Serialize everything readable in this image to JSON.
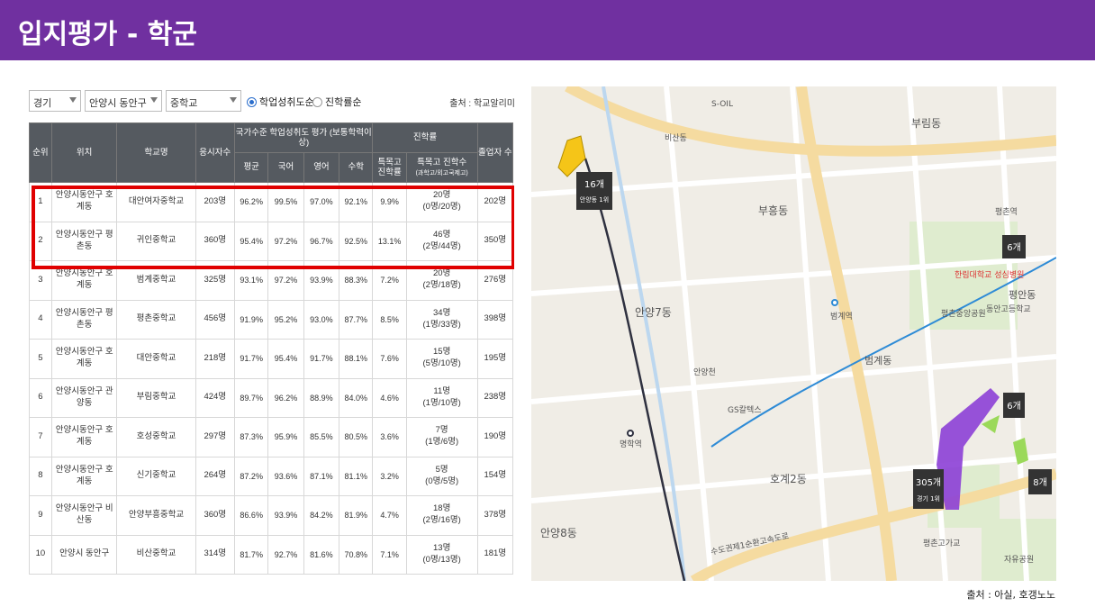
{
  "page": {
    "title": "입지평가 - 학군",
    "credit": "출처 : 아실, 호갱노노"
  },
  "filters": {
    "region": "경기",
    "district": "안양시 동안구",
    "level": "중학교",
    "radio_1": "학업성취도순",
    "radio_2": "진학률순",
    "source": "출처 : 학교알리미"
  },
  "table": {
    "headers": {
      "rank": "순위",
      "location": "위치",
      "school": "학교명",
      "takers": "응시자수",
      "achievement_group": "국가수준 학업성취도 평가 (보통학력이상)",
      "avg": "평균",
      "korean": "국어",
      "english": "영어",
      "math": "수학",
      "advance_group": "진학률",
      "special_rate": "특목고 진학률",
      "special_count": "특목고 진학수",
      "special_count_sub": "(과학고/외고국제고)",
      "graduates": "졸업자 수"
    },
    "rows": [
      {
        "rank": "1",
        "loc": "안양시동안구 호계동",
        "school": "대안여자중학교",
        "takers": "203명",
        "avg": "96.2%",
        "kor": "99.5%",
        "eng": "97.0%",
        "math": "92.1%",
        "rate": "9.9%",
        "cnt": "20명",
        "cnt_sub": "(0명/20명)",
        "grad": "202명"
      },
      {
        "rank": "2",
        "loc": "안양시동안구 평촌동",
        "school": "귀인중학교",
        "takers": "360명",
        "avg": "95.4%",
        "kor": "97.2%",
        "eng": "96.7%",
        "math": "92.5%",
        "rate": "13.1%",
        "cnt": "46명",
        "cnt_sub": "(2명/44명)",
        "grad": "350명"
      },
      {
        "rank": "3",
        "loc": "안양시동안구 호계동",
        "school": "범계중학교",
        "takers": "325명",
        "avg": "93.1%",
        "kor": "97.2%",
        "eng": "93.9%",
        "math": "88.3%",
        "rate": "7.2%",
        "cnt": "20명",
        "cnt_sub": "(2명/18명)",
        "grad": "276명"
      },
      {
        "rank": "4",
        "loc": "안양시동안구 평촌동",
        "school": "평촌중학교",
        "takers": "456명",
        "avg": "91.9%",
        "kor": "95.2%",
        "eng": "93.0%",
        "math": "87.7%",
        "rate": "8.5%",
        "cnt": "34명",
        "cnt_sub": "(1명/33명)",
        "grad": "398명"
      },
      {
        "rank": "5",
        "loc": "안양시동안구 호계동",
        "school": "대안중학교",
        "takers": "218명",
        "avg": "91.7%",
        "kor": "95.4%",
        "eng": "91.7%",
        "math": "88.1%",
        "rate": "7.6%",
        "cnt": "15명",
        "cnt_sub": "(5명/10명)",
        "grad": "195명"
      },
      {
        "rank": "6",
        "loc": "안양시동안구 관양동",
        "school": "부림중학교",
        "takers": "424명",
        "avg": "89.7%",
        "kor": "96.2%",
        "eng": "88.9%",
        "math": "84.0%",
        "rate": "4.6%",
        "cnt": "11명",
        "cnt_sub": "(1명/10명)",
        "grad": "238명"
      },
      {
        "rank": "7",
        "loc": "안양시동안구 호계동",
        "school": "호성중학교",
        "takers": "297명",
        "avg": "87.3%",
        "kor": "95.9%",
        "eng": "85.5%",
        "math": "80.5%",
        "rate": "3.6%",
        "cnt": "7명",
        "cnt_sub": "(1명/6명)",
        "grad": "190명"
      },
      {
        "rank": "8",
        "loc": "안양시동안구 호계동",
        "school": "신기중학교",
        "takers": "264명",
        "avg": "87.2%",
        "kor": "93.6%",
        "eng": "87.1%",
        "math": "81.1%",
        "rate": "3.2%",
        "cnt": "5명",
        "cnt_sub": "(0명/5명)",
        "grad": "154명"
      },
      {
        "rank": "9",
        "loc": "안양시동안구 비산동",
        "school": "안양부흥중학교",
        "takers": "360명",
        "avg": "86.6%",
        "kor": "93.9%",
        "eng": "84.2%",
        "math": "81.9%",
        "rate": "4.7%",
        "cnt": "18명",
        "cnt_sub": "(2명/16명)",
        "grad": "378명"
      },
      {
        "rank": "10",
        "loc": "안양시 동안구",
        "school": "비산중학교",
        "takers": "314명",
        "avg": "81.7%",
        "kor": "92.7%",
        "eng": "81.6%",
        "math": "70.8%",
        "rate": "7.1%",
        "cnt": "13명",
        "cnt_sub": "(0명/13명)",
        "grad": "181명"
      }
    ]
  },
  "map": {
    "badges": [
      {
        "main": "16개",
        "sub": "안양동 1위"
      },
      {
        "main": "6개",
        "sub": ""
      },
      {
        "main": "6개",
        "sub": ""
      },
      {
        "main": "305개",
        "sub": "경기 1위"
      },
      {
        "main": "8개",
        "sub": ""
      }
    ],
    "labels": {
      "soil": "S-OIL",
      "bisan": "비산동",
      "beomgye": "범계역",
      "pyeongchon": "평촌역",
      "anyang7": "안양7동",
      "hogye2": "호계2동",
      "anyang8": "안양8동",
      "myeonghak": "명학역",
      "burim": "부림동",
      "buheung": "부흥동",
      "pyeongan": "평안동",
      "beomgye_dong": "범계동",
      "gsgas": "GS칼텍스",
      "anyangcheon": "안양천",
      "hanrim": "한림대학교 성심병원",
      "dongan_high": "동안고등학교",
      "pyeongchon_park": "평촌중앙공원",
      "expressway": "수도권제1순환고속도로",
      "pyeongchon_overpass": "평촌고가교",
      "jayu_park": "자유공원"
    },
    "colors": {
      "yellow": "#f5c518",
      "purple": "#8c3fd6",
      "green": "#9bd95a",
      "badge": "#333333",
      "road": "#ffffff",
      "major_road": "#f5dba0",
      "rail": "#2f3140",
      "subway": "#2e8bd6"
    }
  }
}
